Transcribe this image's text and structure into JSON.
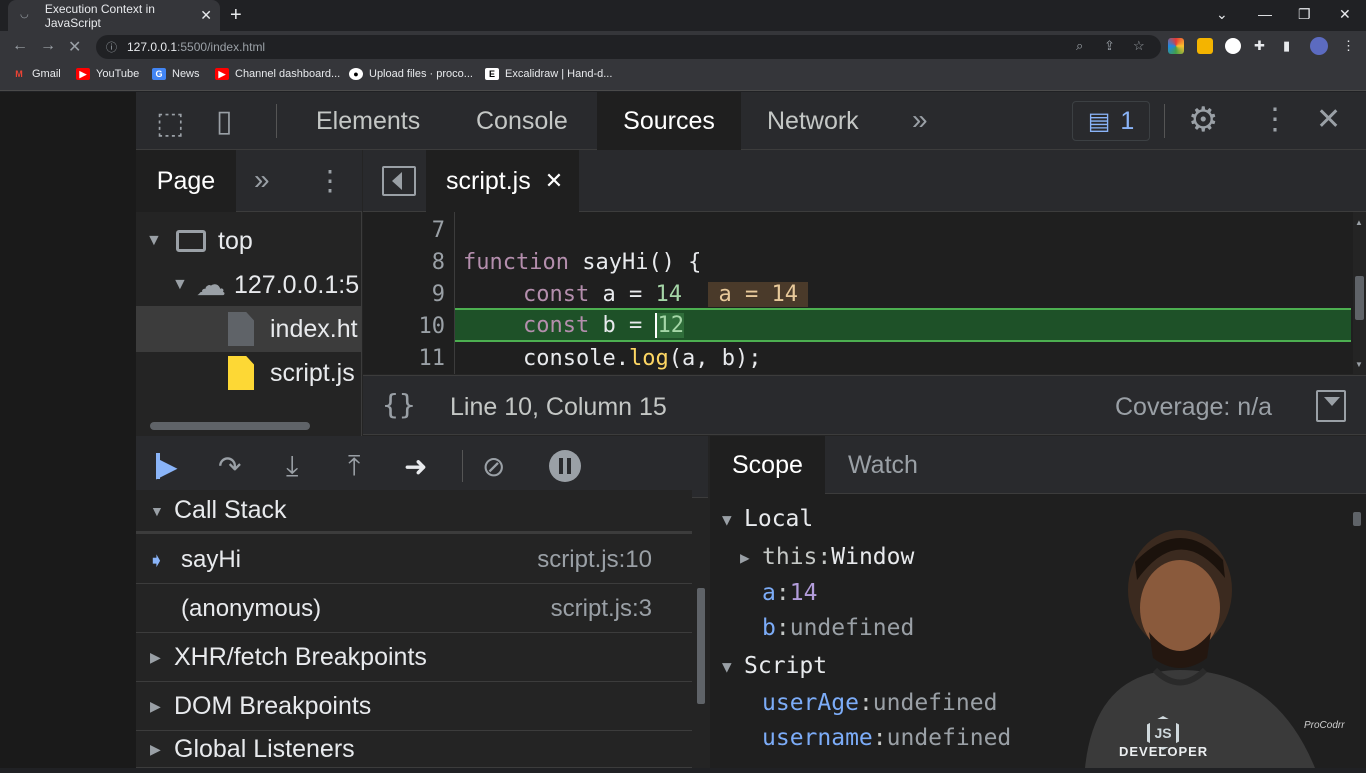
{
  "browser": {
    "tab_title": "Execution Context in JavaScript",
    "url_host": "127.0.0.1",
    "url_path": ":5500/index.html",
    "bookmarks": [
      "Gmail",
      "YouTube",
      "News",
      "Channel dashboard...",
      "Upload files · proco...",
      "Excalidraw | Hand-d..."
    ]
  },
  "devtools": {
    "tabs": [
      "Elements",
      "Console",
      "Sources",
      "Network"
    ],
    "active_tab": "Sources",
    "issues_count": "1"
  },
  "navigator": {
    "tab": "Page",
    "tree": {
      "top": "top",
      "origin": "127.0.0.1:5",
      "file1": "index.ht",
      "file2": "script.js"
    }
  },
  "editor": {
    "file_tab": "script.js",
    "lines": [
      {
        "num": "7",
        "code": ""
      },
      {
        "num": "8",
        "kw": "function",
        "rest": " sayHi() {"
      },
      {
        "num": "9",
        "kw": "const",
        "ident": " a = ",
        "value": "14",
        "inline": "a = 14"
      },
      {
        "num": "10",
        "kw": "const",
        "ident": " b = ",
        "value": "12"
      },
      {
        "num": "11",
        "obj": "console.",
        "method": "log",
        "rest": "(a, b);"
      }
    ],
    "status": "Line 10, Column 15",
    "coverage": "Coverage: n/a"
  },
  "debugger": {
    "call_stack_label": "Call Stack",
    "frames": [
      {
        "name": "sayHi",
        "loc": "script.js:10"
      },
      {
        "name": "(anonymous)",
        "loc": "script.js:3"
      }
    ],
    "sections": [
      "XHR/fetch Breakpoints",
      "DOM Breakpoints",
      "Global Listeners"
    ]
  },
  "scope": {
    "tabs": [
      "Scope",
      "Watch"
    ],
    "local_label": "Local",
    "this_key": "this",
    "this_val": "Window",
    "a_key": "a",
    "a_val": "14",
    "b_key": "b",
    "b_val": "undefined",
    "script_label": "Script",
    "userAge_key": "userAge",
    "userAge_val": "undefined",
    "username_key": "username",
    "username_val": "undefined"
  },
  "overlay": {
    "watermark": "ProCodrr",
    "shirt_text": "DEVELOPER"
  },
  "colors": {
    "current_line": "#1e5128",
    "current_line_border": "#4caf50",
    "accent": "#7cacf8"
  }
}
